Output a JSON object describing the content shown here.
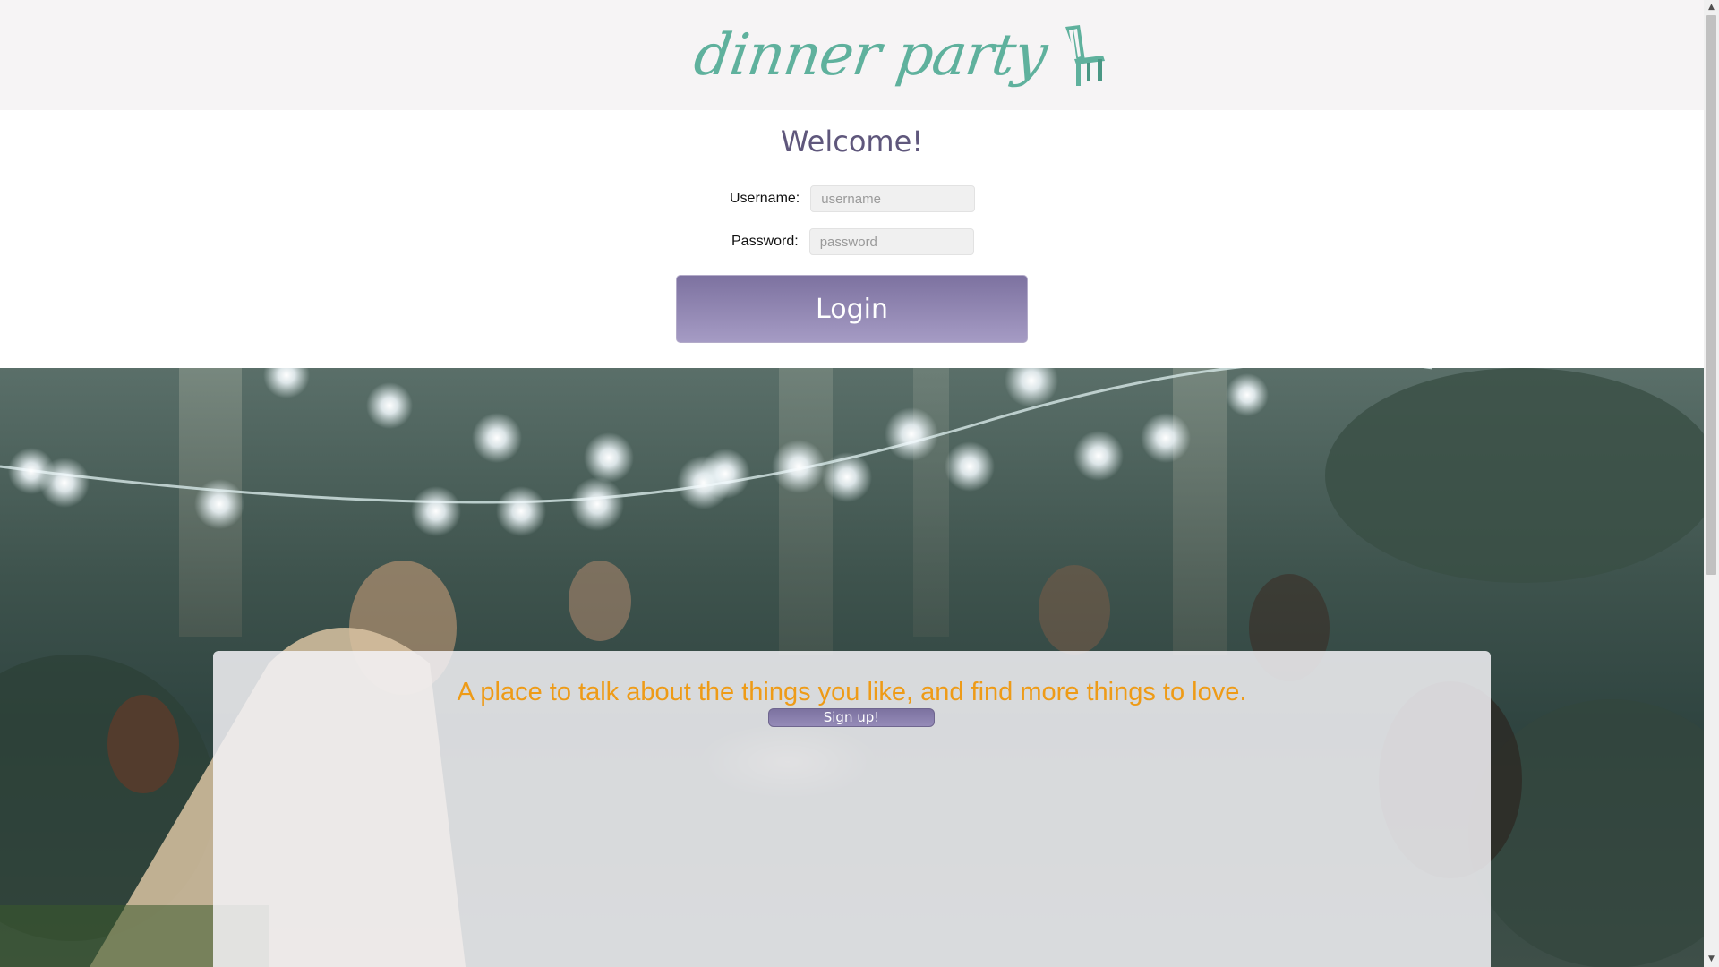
{
  "header": {
    "logo_text": "dinner party",
    "logo_icon": "chair-icon",
    "brand_color": "#5fb19d"
  },
  "login": {
    "title": "Welcome!",
    "username_label": "Username:",
    "username_placeholder": "username",
    "password_label": "Password:",
    "password_placeholder": "password",
    "login_label": "Login",
    "accent_color": "#7d72a0"
  },
  "hero": {
    "tagline": "A place to talk about the things you like, and find more things to love.",
    "signup_label": "Sign up!",
    "tagline_color": "#ee9b17"
  },
  "scrollbar": {
    "up_icon": "scroll-up-arrow-icon",
    "down_icon": "scroll-down-arrow-icon"
  }
}
